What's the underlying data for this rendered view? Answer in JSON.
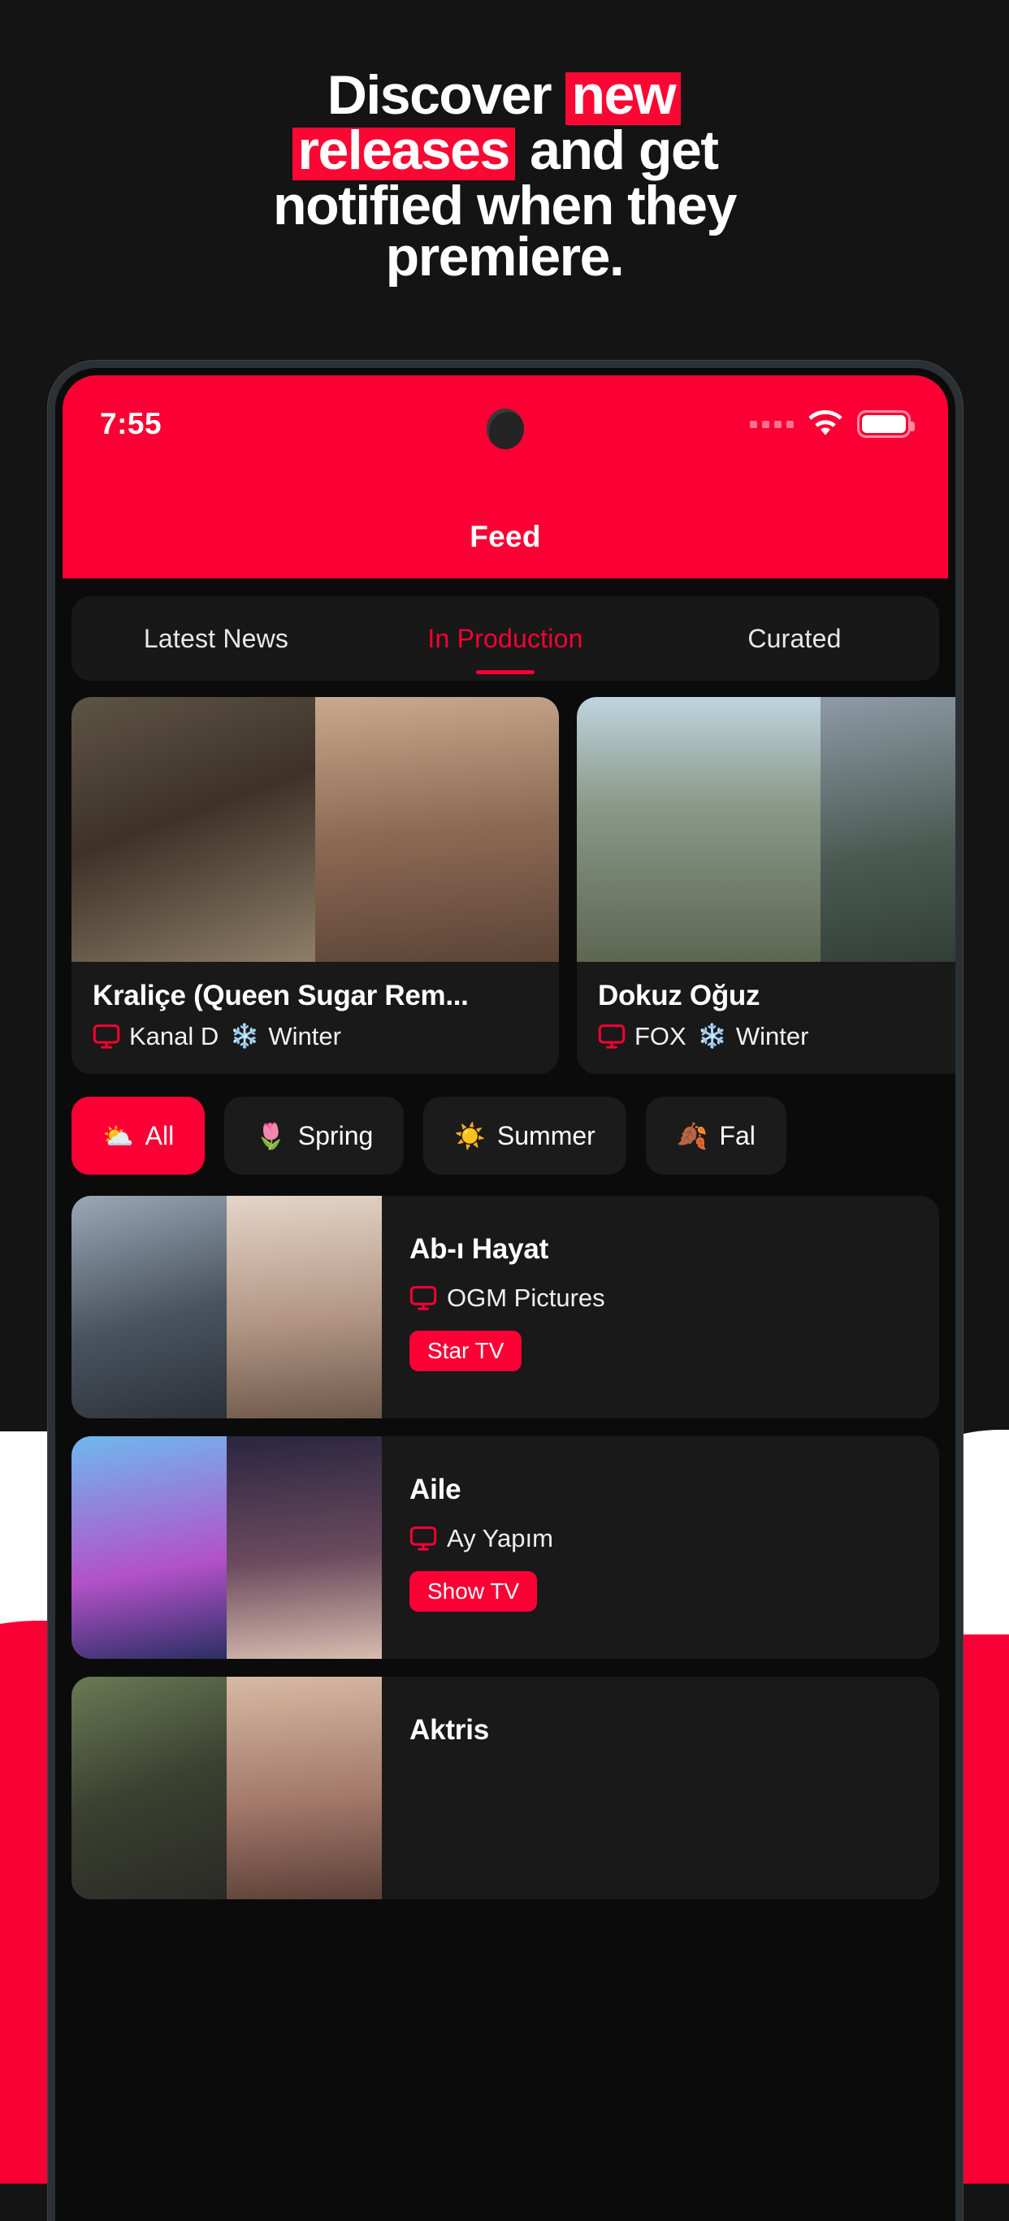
{
  "promo": {
    "headline_lines": [
      [
        {
          "t": "Discover ",
          "hi": false
        },
        {
          "t": "new",
          "hi": true
        }
      ],
      [
        {
          "t": "releases",
          "hi": true
        },
        {
          "t": " and get",
          "hi": false
        }
      ],
      [
        {
          "t": "notified when they",
          "hi": false
        }
      ],
      [
        {
          "t": "premiere.",
          "hi": false
        }
      ]
    ],
    "accent_color": "#FB0733",
    "background_color": "#141414"
  },
  "status_bar": {
    "time": "7:55",
    "signal_icon": "signal-dots-icon",
    "wifi_icon": "wifi-icon",
    "battery_icon": "battery-icon"
  },
  "app": {
    "title": "Feed",
    "header_color": "#FB0034"
  },
  "tabs": [
    {
      "label": "Latest News",
      "active": false
    },
    {
      "label": "In Production",
      "active": true
    },
    {
      "label": "Curated",
      "active": false
    }
  ],
  "carousel": [
    {
      "title": "Kraliçe (Queen Sugar Rem...",
      "channel": "Kanal D",
      "channel_icon": "tv-icon",
      "season": "Winter",
      "season_icon": "snowflake-emoji"
    },
    {
      "title": "Dokuz Oğuz",
      "channel": "FOX",
      "channel_icon": "tv-icon",
      "season": "Winter",
      "season_icon": "snowflake-emoji"
    }
  ],
  "filter_chips": [
    {
      "label": "All",
      "emoji": "⛅",
      "active": true
    },
    {
      "label": "Spring",
      "emoji": "🌷",
      "active": false
    },
    {
      "label": "Summer",
      "emoji": "☀️",
      "active": false
    },
    {
      "label": "Fal",
      "emoji": "🍂",
      "active": false
    }
  ],
  "list": [
    {
      "title": "Ab-ı Hayat",
      "producer": "OGM Pictures",
      "producer_icon": "tv-icon",
      "badge": "Star TV"
    },
    {
      "title": "Aile",
      "producer": "Ay Yapım",
      "producer_icon": "tv-icon",
      "badge": "Show TV"
    },
    {
      "title": "Aktris",
      "producer": "",
      "producer_icon": "tv-icon",
      "badge": ""
    }
  ]
}
